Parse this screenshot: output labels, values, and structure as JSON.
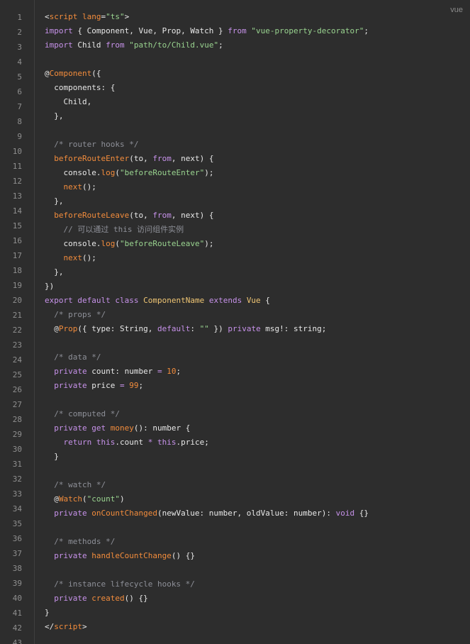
{
  "colors": {
    "background": "#2d2d2d",
    "gutter_border": "#3f3f3f",
    "line_number": "#8f8f8f",
    "keyword": "#c792ea",
    "string": "#99d38f",
    "comment": "#8e9098",
    "function": "#f28c3c",
    "class": "#f0c674",
    "number": "#f28c3c",
    "plain": "#e8e8e8"
  },
  "language_label": "vue",
  "line_numbers": [
    "1",
    "2",
    "3",
    "4",
    "5",
    "6",
    "7",
    "8",
    "9",
    "10",
    "11",
    "12",
    "13",
    "14",
    "15",
    "16",
    "17",
    "18",
    "19",
    "20",
    "21",
    "22",
    "23",
    "24",
    "25",
    "26",
    "27",
    "28",
    "29",
    "30",
    "31",
    "32",
    "33",
    "34",
    "35",
    "36",
    "37",
    "38",
    "39",
    "40",
    "41",
    "42",
    "43"
  ],
  "lines": [
    [
      {
        "t": "plain",
        "v": "<"
      },
      {
        "t": "tag",
        "v": "script"
      },
      {
        "t": "plain",
        "v": " "
      },
      {
        "t": "function",
        "v": "lang"
      },
      {
        "t": "plain",
        "v": "="
      },
      {
        "t": "string",
        "v": "\"ts\""
      },
      {
        "t": "plain",
        "v": ">"
      }
    ],
    [
      {
        "t": "keyword",
        "v": "import"
      },
      {
        "t": "plain",
        "v": " { Component, Vue, Prop, Watch } "
      },
      {
        "t": "keyword",
        "v": "from"
      },
      {
        "t": "plain",
        "v": " "
      },
      {
        "t": "string",
        "v": "\"vue-property-decorator\""
      },
      {
        "t": "plain",
        "v": ";"
      }
    ],
    [
      {
        "t": "keyword",
        "v": "import"
      },
      {
        "t": "plain",
        "v": " Child "
      },
      {
        "t": "keyword",
        "v": "from"
      },
      {
        "t": "plain",
        "v": " "
      },
      {
        "t": "string",
        "v": "\"path/to/Child.vue\""
      },
      {
        "t": "plain",
        "v": ";"
      }
    ],
    [],
    [
      {
        "t": "plain",
        "v": "@"
      },
      {
        "t": "function",
        "v": "Component"
      },
      {
        "t": "plain",
        "v": "({"
      }
    ],
    [
      {
        "t": "plain",
        "v": "  components: {"
      }
    ],
    [
      {
        "t": "plain",
        "v": "    Child,"
      }
    ],
    [
      {
        "t": "plain",
        "v": "  },"
      }
    ],
    [],
    [
      {
        "t": "plain",
        "v": "  "
      },
      {
        "t": "comment",
        "v": "/* router hooks */"
      }
    ],
    [
      {
        "t": "plain",
        "v": "  "
      },
      {
        "t": "function",
        "v": "beforeRouteEnter"
      },
      {
        "t": "plain",
        "v": "(to, "
      },
      {
        "t": "keyword",
        "v": "from"
      },
      {
        "t": "plain",
        "v": ", next) {"
      }
    ],
    [
      {
        "t": "plain",
        "v": "    console."
      },
      {
        "t": "function",
        "v": "log"
      },
      {
        "t": "plain",
        "v": "("
      },
      {
        "t": "string",
        "v": "\"beforeRouteEnter\""
      },
      {
        "t": "plain",
        "v": ");"
      }
    ],
    [
      {
        "t": "plain",
        "v": "    "
      },
      {
        "t": "function",
        "v": "next"
      },
      {
        "t": "plain",
        "v": "();"
      }
    ],
    [
      {
        "t": "plain",
        "v": "  },"
      }
    ],
    [
      {
        "t": "plain",
        "v": "  "
      },
      {
        "t": "function",
        "v": "beforeRouteLeave"
      },
      {
        "t": "plain",
        "v": "(to, "
      },
      {
        "t": "keyword",
        "v": "from"
      },
      {
        "t": "plain",
        "v": ", next) {"
      }
    ],
    [
      {
        "t": "plain",
        "v": "    "
      },
      {
        "t": "comment",
        "v": "// 可以通过 this 访问组件实例"
      }
    ],
    [
      {
        "t": "plain",
        "v": "    console."
      },
      {
        "t": "function",
        "v": "log"
      },
      {
        "t": "plain",
        "v": "("
      },
      {
        "t": "string",
        "v": "\"beforeRouteLeave\""
      },
      {
        "t": "plain",
        "v": ");"
      }
    ],
    [
      {
        "t": "plain",
        "v": "    "
      },
      {
        "t": "function",
        "v": "next"
      },
      {
        "t": "plain",
        "v": "();"
      }
    ],
    [
      {
        "t": "plain",
        "v": "  },"
      }
    ],
    [
      {
        "t": "plain",
        "v": "})"
      }
    ],
    [
      {
        "t": "keyword",
        "v": "export"
      },
      {
        "t": "plain",
        "v": " "
      },
      {
        "t": "keyword",
        "v": "default"
      },
      {
        "t": "plain",
        "v": " "
      },
      {
        "t": "keyword",
        "v": "class"
      },
      {
        "t": "plain",
        "v": " "
      },
      {
        "t": "class",
        "v": "ComponentName"
      },
      {
        "t": "plain",
        "v": " "
      },
      {
        "t": "keyword",
        "v": "extends"
      },
      {
        "t": "plain",
        "v": " "
      },
      {
        "t": "class",
        "v": "Vue"
      },
      {
        "t": "plain",
        "v": " {"
      }
    ],
    [
      {
        "t": "plain",
        "v": "  "
      },
      {
        "t": "comment",
        "v": "/* props */"
      }
    ],
    [
      {
        "t": "plain",
        "v": "  @"
      },
      {
        "t": "function",
        "v": "Prop"
      },
      {
        "t": "plain",
        "v": "({ type: String, "
      },
      {
        "t": "keyword",
        "v": "default"
      },
      {
        "t": "plain",
        "v": ": "
      },
      {
        "t": "string",
        "v": "\"\""
      },
      {
        "t": "plain",
        "v": " }) "
      },
      {
        "t": "keyword",
        "v": "private"
      },
      {
        "t": "plain",
        "v": " msg!: string;"
      }
    ],
    [],
    [
      {
        "t": "plain",
        "v": "  "
      },
      {
        "t": "comment",
        "v": "/* data */"
      }
    ],
    [
      {
        "t": "plain",
        "v": "  "
      },
      {
        "t": "keyword",
        "v": "private"
      },
      {
        "t": "plain",
        "v": " count: number "
      },
      {
        "t": "keyword",
        "v": "="
      },
      {
        "t": "plain",
        "v": " "
      },
      {
        "t": "number",
        "v": "10"
      },
      {
        "t": "plain",
        "v": ";"
      }
    ],
    [
      {
        "t": "plain",
        "v": "  "
      },
      {
        "t": "keyword",
        "v": "private"
      },
      {
        "t": "plain",
        "v": " price "
      },
      {
        "t": "keyword",
        "v": "="
      },
      {
        "t": "plain",
        "v": " "
      },
      {
        "t": "number",
        "v": "99"
      },
      {
        "t": "plain",
        "v": ";"
      }
    ],
    [],
    [
      {
        "t": "plain",
        "v": "  "
      },
      {
        "t": "comment",
        "v": "/* computed */"
      }
    ],
    [
      {
        "t": "plain",
        "v": "  "
      },
      {
        "t": "keyword",
        "v": "private"
      },
      {
        "t": "plain",
        "v": " "
      },
      {
        "t": "keyword",
        "v": "get"
      },
      {
        "t": "plain",
        "v": " "
      },
      {
        "t": "function",
        "v": "money"
      },
      {
        "t": "plain",
        "v": "(): number {"
      }
    ],
    [
      {
        "t": "plain",
        "v": "    "
      },
      {
        "t": "keyword",
        "v": "return"
      },
      {
        "t": "plain",
        "v": " "
      },
      {
        "t": "keyword",
        "v": "this"
      },
      {
        "t": "plain",
        "v": ".count "
      },
      {
        "t": "keyword",
        "v": "*"
      },
      {
        "t": "plain",
        "v": " "
      },
      {
        "t": "keyword",
        "v": "this"
      },
      {
        "t": "plain",
        "v": ".price;"
      }
    ],
    [
      {
        "t": "plain",
        "v": "  }"
      }
    ],
    [],
    [
      {
        "t": "plain",
        "v": "  "
      },
      {
        "t": "comment",
        "v": "/* watch */"
      }
    ],
    [
      {
        "t": "plain",
        "v": "  @"
      },
      {
        "t": "function",
        "v": "Watch"
      },
      {
        "t": "plain",
        "v": "("
      },
      {
        "t": "string",
        "v": "\"count\""
      },
      {
        "t": "plain",
        "v": ")"
      }
    ],
    [
      {
        "t": "plain",
        "v": "  "
      },
      {
        "t": "keyword",
        "v": "private"
      },
      {
        "t": "plain",
        "v": " "
      },
      {
        "t": "function",
        "v": "onCountChanged"
      },
      {
        "t": "plain",
        "v": "(newValue: number, oldValue: number): "
      },
      {
        "t": "keyword",
        "v": "void"
      },
      {
        "t": "plain",
        "v": " {}"
      }
    ],
    [],
    [
      {
        "t": "plain",
        "v": "  "
      },
      {
        "t": "comment",
        "v": "/* methods */"
      }
    ],
    [
      {
        "t": "plain",
        "v": "  "
      },
      {
        "t": "keyword",
        "v": "private"
      },
      {
        "t": "plain",
        "v": " "
      },
      {
        "t": "function",
        "v": "handleCountChange"
      },
      {
        "t": "plain",
        "v": "() {}"
      }
    ],
    [],
    [
      {
        "t": "plain",
        "v": "  "
      },
      {
        "t": "comment",
        "v": "/* instance lifecycle hooks */"
      }
    ],
    [
      {
        "t": "plain",
        "v": "  "
      },
      {
        "t": "keyword",
        "v": "private"
      },
      {
        "t": "plain",
        "v": " "
      },
      {
        "t": "function",
        "v": "created"
      },
      {
        "t": "plain",
        "v": "() {}"
      }
    ],
    [
      {
        "t": "plain",
        "v": "}"
      }
    ],
    [
      {
        "t": "plain",
        "v": "</"
      },
      {
        "t": "tag",
        "v": "script"
      },
      {
        "t": "plain",
        "v": ">"
      }
    ]
  ]
}
